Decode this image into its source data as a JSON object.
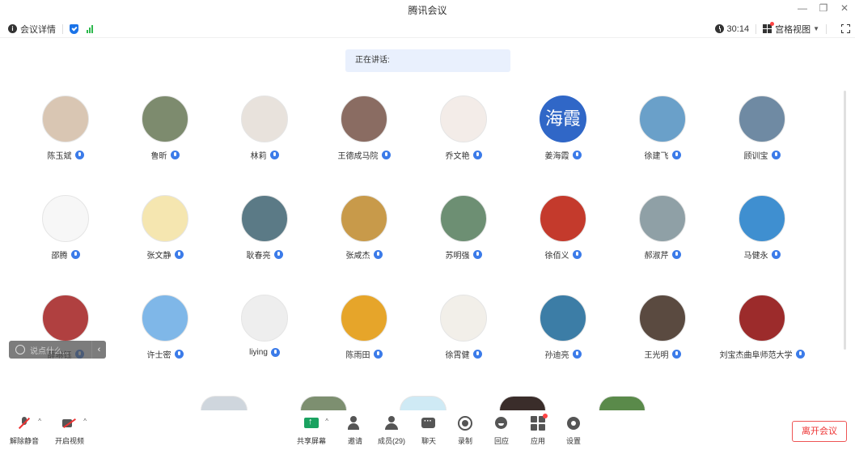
{
  "window": {
    "title": "腾讯会议"
  },
  "infobar": {
    "meeting_details": "会议详情",
    "elapsed": "30:14",
    "view_mode": "宫格视图"
  },
  "speaking": {
    "label": "正在讲话:"
  },
  "participants": [
    {
      "name": "陈玉斌",
      "avatar_color": "#d9c6b3"
    },
    {
      "name": "鲁昕",
      "avatar_color": "#7d8b6e"
    },
    {
      "name": "林莉",
      "avatar_color": "#e8e2dc"
    },
    {
      "name": "王德成马院",
      "avatar_color": "#8a6c62"
    },
    {
      "name": "乔文艳",
      "avatar_color": "#f3ece8"
    },
    {
      "name": "姜海霞",
      "avatar_text": "海霞",
      "avatar_color": "#3067c7"
    },
    {
      "name": "徐建飞",
      "avatar_color": "#6aa0c9"
    },
    {
      "name": "顾训宝",
      "avatar_color": "#6f8aa3"
    },
    {
      "name": "邵腾",
      "avatar_color": "#f7f7f7"
    },
    {
      "name": "张文静",
      "avatar_color": "#f5e6b0"
    },
    {
      "name": "耿春亮",
      "avatar_color": "#5b7a86"
    },
    {
      "name": "张咸杰",
      "avatar_color": "#c89a4a"
    },
    {
      "name": "苏明强",
      "avatar_color": "#6d8f73"
    },
    {
      "name": "徐佰义",
      "avatar_color": "#c43a2c"
    },
    {
      "name": "郝淑芹",
      "avatar_color": "#8fa0a6"
    },
    {
      "name": "马健永",
      "avatar_color": "#3f8fd0"
    },
    {
      "name": "薛琳钰",
      "avatar_color": "#b04040"
    },
    {
      "name": "许士密",
      "avatar_color": "#7fb7e8"
    },
    {
      "name": "liying",
      "avatar_color": "#eeeeee"
    },
    {
      "name": "陈雨田",
      "avatar_color": "#e6a52a"
    },
    {
      "name": "徐霄健",
      "avatar_color": "#f2efe9"
    },
    {
      "name": "孙迪亮",
      "avatar_color": "#3c7da6"
    },
    {
      "name": "王光明",
      "avatar_color": "#5a4a40"
    },
    {
      "name": "刘宝杰曲阜师范大学",
      "avatar_color": "#9c2b2b"
    }
  ],
  "partial_row": [
    {
      "avatar_color": "#cfd6dd"
    },
    {
      "avatar_color": "#7d8f70"
    },
    {
      "avatar_color": "#cfeaf5"
    },
    {
      "avatar_color": "#3a2d2a"
    },
    {
      "avatar_color": "#5a8a4a"
    }
  ],
  "chat": {
    "placeholder": "说点什么..."
  },
  "toolbar": {
    "unmute": "解除静音",
    "start_video": "开启视频",
    "share_screen": "共享屏幕",
    "invite": "邀请",
    "members": "成员(29)",
    "chat": "聊天",
    "record": "录制",
    "react": "回应",
    "apps": "应用",
    "settings": "设置",
    "leave": "离开会议"
  }
}
